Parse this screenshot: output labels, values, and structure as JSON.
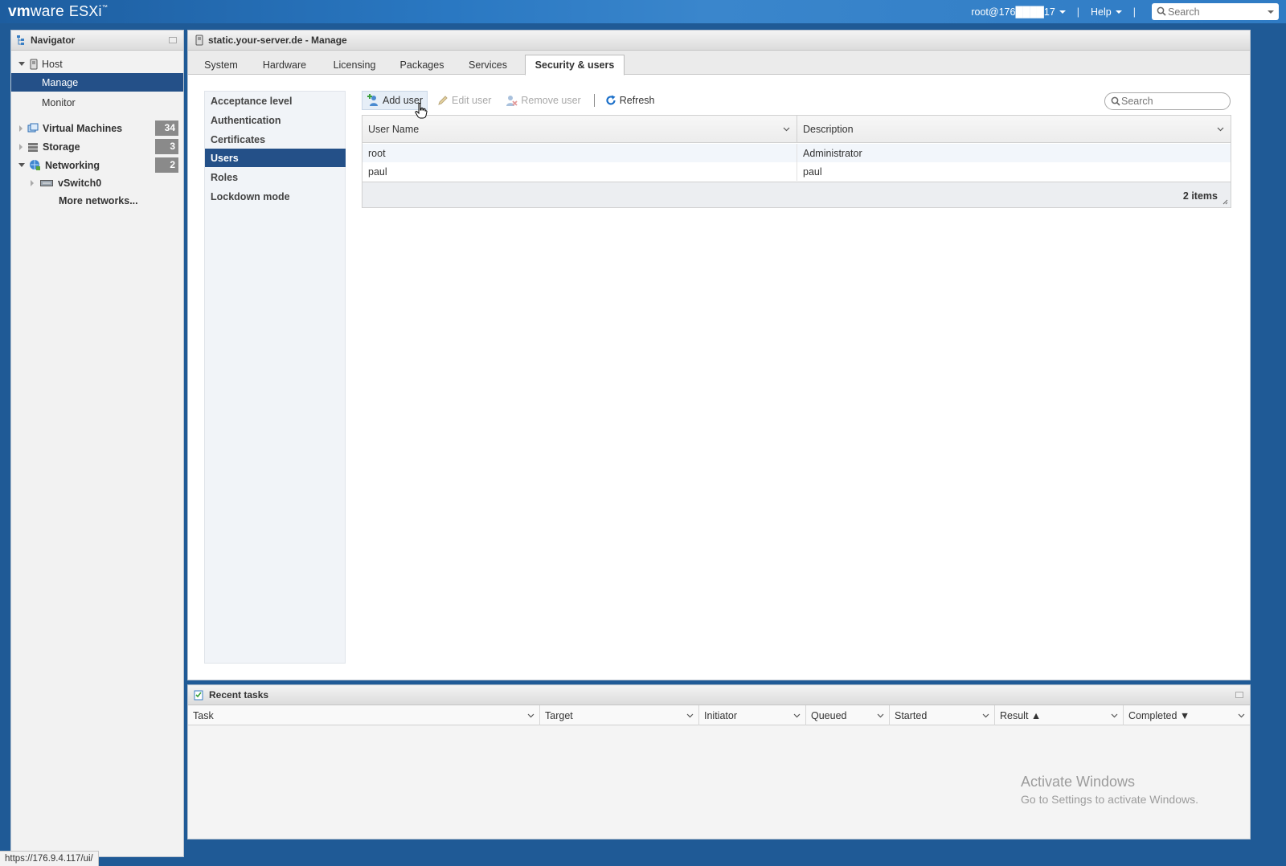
{
  "app": {
    "brand_vm": "vm",
    "brand_ware": "ware",
    "brand_product": "ESXi",
    "brand_tm": "™"
  },
  "topbar": {
    "user": "root@176████17",
    "help": "Help",
    "separator": "|",
    "search_placeholder": "Search"
  },
  "navigator": {
    "title": "Navigator",
    "host_label": "Host",
    "manage_label": "Manage",
    "monitor_label": "Monitor",
    "vms_label": "Virtual Machines",
    "vms_count": "34",
    "storage_label": "Storage",
    "storage_count": "3",
    "networking_label": "Networking",
    "networking_count": "2",
    "vswitch_label": "vSwitch0",
    "more_networks": "More networks..."
  },
  "main": {
    "title": "static.your-server.de - Manage",
    "tabs": [
      "System",
      "Hardware",
      "Licensing",
      "Packages",
      "Services",
      "Security & users"
    ],
    "active_tab": "Security & users",
    "subnav": [
      "Acceptance level",
      "Authentication",
      "Certificates",
      "Users",
      "Roles",
      "Lockdown mode"
    ],
    "subnav_selected": "Users",
    "toolbar": {
      "add_user": "Add user",
      "edit_user": "Edit user",
      "remove_user": "Remove user",
      "refresh": "Refresh"
    },
    "search_placeholder": "Search",
    "grid": {
      "columns": [
        "User Name",
        "Description"
      ],
      "rows": [
        {
          "username": "root",
          "description": "Administrator"
        },
        {
          "username": "paul",
          "description": "paul"
        }
      ],
      "count": "2 items"
    }
  },
  "recent_tasks": {
    "title": "Recent tasks",
    "columns": [
      "Task",
      "Target",
      "Initiator",
      "Queued",
      "Started",
      "Result ▲",
      "Completed ▼"
    ]
  },
  "watermark": {
    "line1": "Activate Windows",
    "line2": "Go to Settings to activate Windows."
  },
  "status_url": "https://176.9.4.117/ui/",
  "colors": {
    "topbar": "#2a78c2",
    "selected": "#245088",
    "badge": "#8a8a8a",
    "refresh": "#1a6fc9"
  }
}
